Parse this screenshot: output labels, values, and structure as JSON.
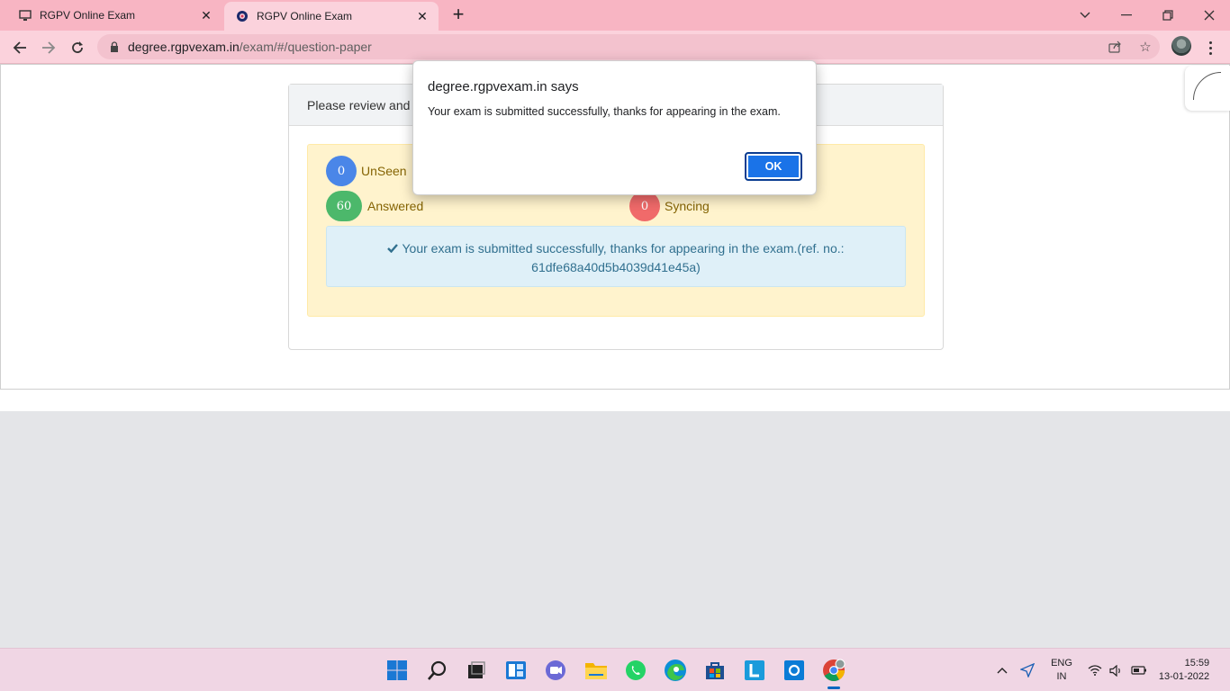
{
  "browser": {
    "tabs": [
      {
        "title": "RGPV Online Exam",
        "active": false
      },
      {
        "title": "RGPV Online Exam",
        "active": true
      }
    ],
    "new_tab": "+",
    "url_host": "degree.rgpvexam.in",
    "url_path": "/exam/#/question-paper"
  },
  "page": {
    "card_header": "Please review and c",
    "unseen_count": "0",
    "unseen_label": "UnSeen",
    "answered_count": "60",
    "answered_label": "Answered",
    "syncing_count": "0",
    "syncing_label": "Syncing",
    "success_line1": "Your exam is submitted successfully, thanks for appearing in the exam.(ref. no.:",
    "success_line2": "61dfe68a40d5b4039d41e45a)"
  },
  "dialog": {
    "title": "degree.rgpvexam.in says",
    "message": "Your exam is submitted successfully, thanks for appearing in the exam.",
    "ok_label": "OK"
  },
  "taskbar": {
    "lang_top": "ENG",
    "lang_bottom": "IN",
    "time": "15:59",
    "date": "13-01-2022"
  },
  "colors": {
    "tab_strip": "#f8b5c3",
    "toolbar": "#fbd2dc",
    "ok_button": "#1a73e8",
    "unseen": "#4a86e8",
    "answered": "#4cb86b",
    "syncing": "#f06a6a"
  }
}
